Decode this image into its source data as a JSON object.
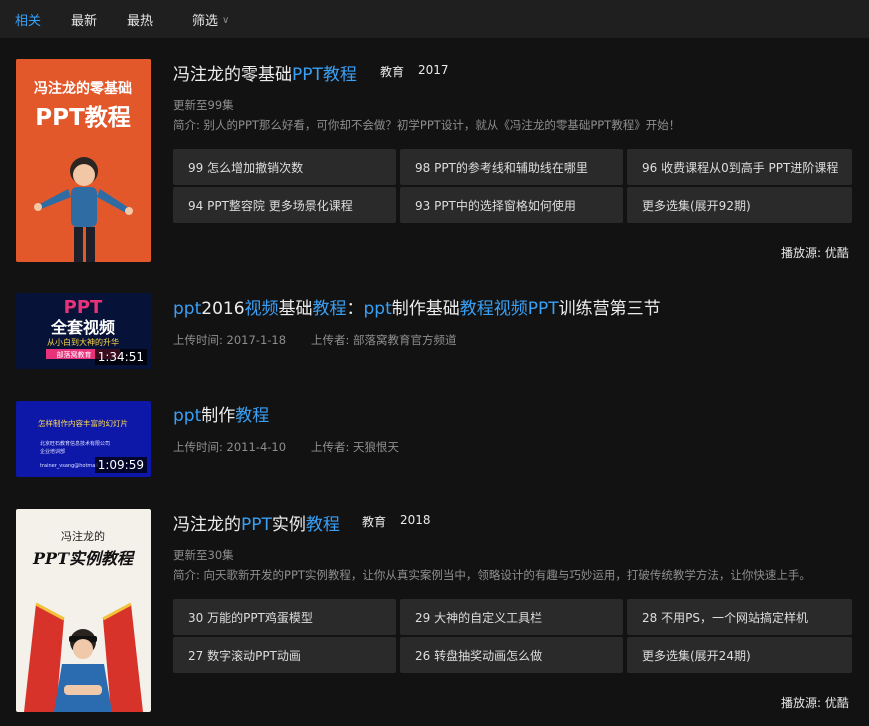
{
  "nav": {
    "tabs": [
      "相关",
      "最新",
      "最热"
    ],
    "filter_label": "筛选"
  },
  "results": [
    {
      "type": "series",
      "thumb": {
        "line1": "冯注龙的零基础",
        "line2": "PPT教程"
      },
      "title_parts": [
        {
          "text": "冯注龙的零基础",
          "hl": false
        },
        {
          "text": "PPT教程",
          "hl": true
        }
      ],
      "category": "教育",
      "year": "2017",
      "update": "更新至99集",
      "desc": "简介: 别人的PPT那么好看，可你却不会做？初学PPT设计，就从《冯注龙的零基础PPT教程》开始！",
      "episodes": [
        "99 怎么增加撤销次数",
        "98 PPT的参考线和辅助线在哪里",
        "96 收费课程从0到高手 PPT进阶课程",
        "94 PPT整容院 更多场景化课程",
        "93 PPT中的选择窗格如何使用",
        "更多选集(展开92期)"
      ],
      "source": "播放源: 优酷"
    },
    {
      "type": "video",
      "thumb": {
        "line1": "PPT",
        "line2": "全套视频",
        "line3": "从小白到大神的升华",
        "line4": "部落窝教育"
      },
      "duration": "1:34:51",
      "title_parts": [
        {
          "text": "ppt",
          "hl": true
        },
        {
          "text": "2016",
          "hl": false
        },
        {
          "text": "视频",
          "hl": true
        },
        {
          "text": "基础",
          "hl": false
        },
        {
          "text": "教程",
          "hl": true
        },
        {
          "text": "：",
          "hl": false
        },
        {
          "text": "ppt",
          "hl": true
        },
        {
          "text": "制作基础",
          "hl": false
        },
        {
          "text": "教程视频PPT",
          "hl": true
        },
        {
          "text": "训练营第三节",
          "hl": false
        }
      ],
      "upload_time": "上传时间: 2017-1-18",
      "uploader": "上传者: 部落窝教育官方频道"
    },
    {
      "type": "video",
      "thumb": {
        "line1": "怎样制作内容丰富的幻灯片",
        "line2": "北京旺石教育信息技术有限公司",
        "line3": "企业培训部",
        "line4": "trainer_vsang@hotmail"
      },
      "duration": "1:09:59",
      "title_parts": [
        {
          "text": "ppt",
          "hl": true
        },
        {
          "text": "制作",
          "hl": false
        },
        {
          "text": "教程",
          "hl": true
        }
      ],
      "upload_time": "上传时间: 2011-4-10",
      "uploader": "上传者: 天狼恨天"
    },
    {
      "type": "series",
      "thumb": {
        "line1": "冯注龙的",
        "line2": "PPT实例教程"
      },
      "title_parts": [
        {
          "text": "冯注龙的",
          "hl": false
        },
        {
          "text": "PPT",
          "hl": true
        },
        {
          "text": "实例",
          "hl": false
        },
        {
          "text": "教程",
          "hl": true
        }
      ],
      "category": "教育",
      "year": "2018",
      "update": "更新至30集",
      "desc": "简介: 向天歌新开发的PPT实例教程，让你从真实案例当中，领略设计的有趣与巧妙运用，打破传统教学方法，让你快速上手。",
      "episodes": [
        "30 万能的PPT鸡蛋模型",
        "29 大神的自定义工具栏",
        "28 不用PS，一个网站搞定样机",
        "27 数字滚动PPT动画",
        "26 转盘抽奖动画怎么做",
        "更多选集(展开24期)"
      ],
      "source": "播放源: 优酷"
    }
  ]
}
